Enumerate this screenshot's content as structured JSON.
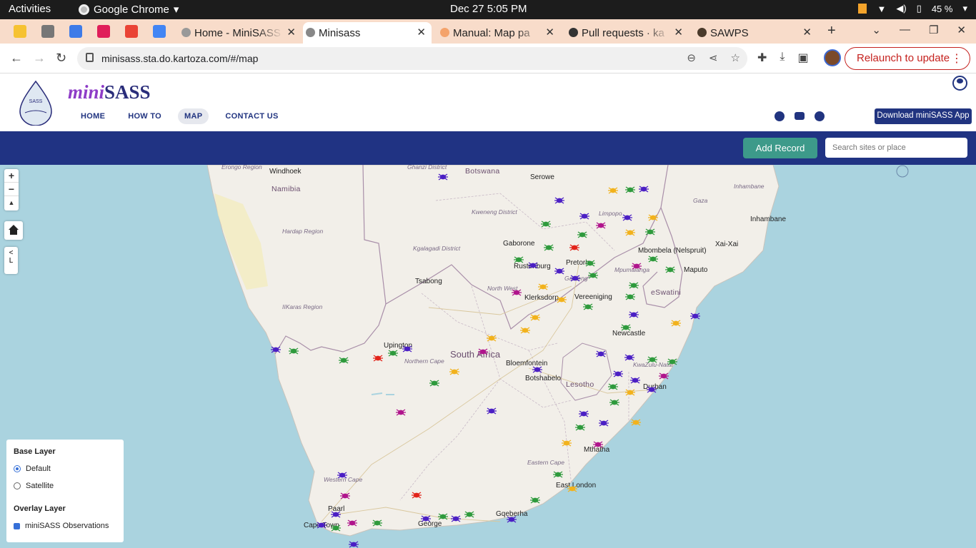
{
  "system": {
    "activities": "Activities",
    "app_name": "Google Chrome",
    "datetime": "Dec 27  5:05 PM",
    "battery": "45 %"
  },
  "tabs": [
    {
      "label": "Home - MiniSASS",
      "active": false
    },
    {
      "label": "Minisass",
      "active": true
    },
    {
      "label": "Manual: Map pa",
      "active": false
    },
    {
      "label": "Pull requests · ka",
      "active": false
    },
    {
      "label": "SAWPS",
      "active": false
    }
  ],
  "omnibox": {
    "url": "minisass.sta.do.kartoza.com/#/map",
    "relaunch": "Relaunch to update"
  },
  "site": {
    "brand_mini": "mini",
    "brand_sass": "SASS",
    "nav": [
      "HOME",
      "HOW TO",
      "MAP",
      "CONTACT US"
    ],
    "download_label": "Download miniSASS App",
    "add_record": "Add Record",
    "search_placeholder": "Search sites or place"
  },
  "legend": {
    "base_title": "Base Layer",
    "base_options": [
      "Default",
      "Satellite"
    ],
    "base_selected": "Default",
    "overlay_title": "Overlay Layer",
    "overlay_option": "miniSASS Observations",
    "overlay_checked": true
  },
  "map_controls": {
    "zoom_in": "+",
    "zoom_out": "−",
    "layer_toggle": "L"
  },
  "map": {
    "cities": [
      "Windhoek",
      "Gaborone",
      "Rustenburg",
      "Pretoria",
      "Bloemfontein",
      "Upington",
      "Durban",
      "Gqeberha",
      "George",
      "Cape Town",
      "East London",
      "Maputo",
      "Newcastle",
      "Klerksdorp",
      "Vereeniging",
      "Mbombela (Nelspruit)",
      "Serowe",
      "Tsabong",
      "Botshabelo",
      "Mthatha",
      "Paarl",
      "Inhambane",
      "Xai-Xai"
    ],
    "countries": [
      "Namibia",
      "Botswana",
      "South Africa",
      "Lesotho",
      "eSwatini"
    ],
    "regions": [
      "Erongo Region",
      "Hardap Region",
      "IIKaras Region",
      "Kweneng District",
      "Kgalagadi District",
      "Ghanzi District",
      "North West",
      "Northern Cape",
      "Limpopo",
      "Mpumalanga",
      "Gauteng",
      "KwaZulu-Natal",
      "Eastern Cape",
      "Western Cape",
      "Gaza",
      "Inhambane"
    ],
    "marker_colors": {
      "purple_blue": "#4b1fc4",
      "green": "#2e9a3c",
      "orange": "#f2b21c",
      "magenta": "#b0148c",
      "red": "#e2231a"
    }
  }
}
